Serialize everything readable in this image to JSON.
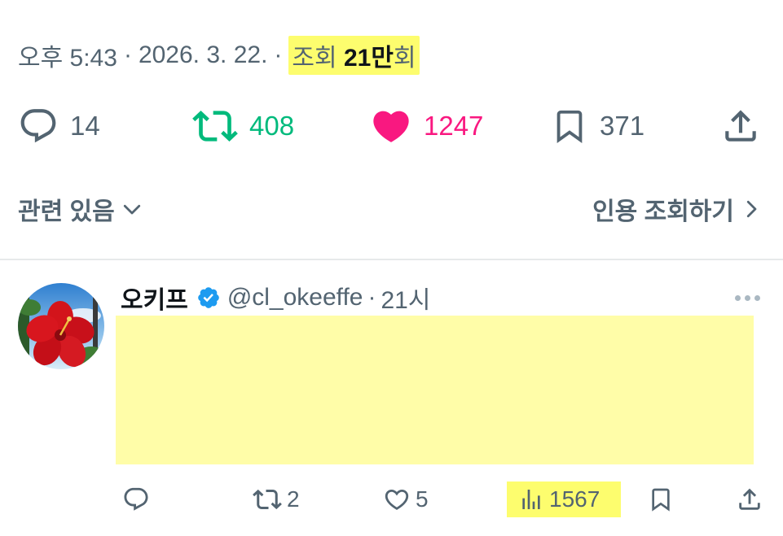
{
  "post_meta": {
    "time": "오후 5:43",
    "separator": "·",
    "date": "2026. 3. 22.",
    "views_prefix": "조회",
    "views_count": "21만",
    "views_suffix": "회"
  },
  "actions": {
    "replies": "14",
    "retweets": "408",
    "likes": "1247",
    "bookmarks": "371"
  },
  "related": {
    "label": "관련 있음",
    "quote_label": "인용 조회하기"
  },
  "reply": {
    "display_name": "오키프",
    "handle": "@cl_okeeffe",
    "separator": "·",
    "time": "21시",
    "retweets": "2",
    "likes": "5",
    "views": "1567"
  },
  "colors": {
    "muted": "#536471",
    "retweet": "#00ba7c",
    "like": "#f91880",
    "verified": "#1d9bf0",
    "highlight": "#fdfd6e"
  },
  "icons": [
    "reply-icon",
    "retweet-icon",
    "heart-icon",
    "bookmark-icon",
    "share-icon",
    "chevron-down-icon",
    "chevron-right-icon",
    "verified-badge-icon",
    "more-icon",
    "views-icon"
  ]
}
